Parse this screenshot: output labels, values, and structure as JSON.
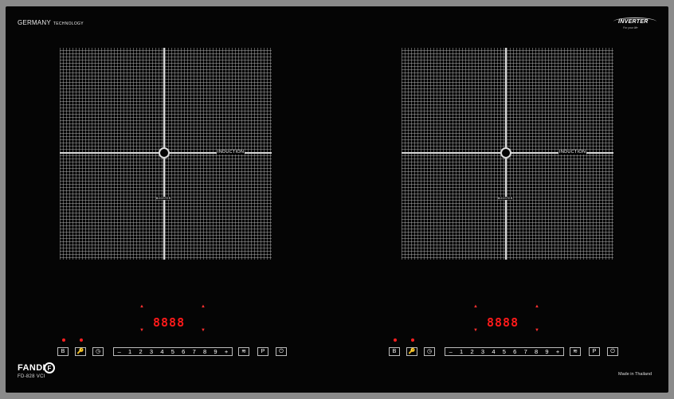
{
  "brand": {
    "top_left": "GERMANY",
    "top_left_small": "TECHNOLOGY",
    "inverter": "INVERTER",
    "inverter_tag": "For your life",
    "logo_name": "FANDI",
    "logo_letter": "F",
    "model": "FD-828 VCI",
    "made_in": "Made in Thailand"
  },
  "zones": [
    {
      "induction_label": "INDUCTION",
      "booster_label": "BOOSTER"
    },
    {
      "induction_label": "INDUCTION",
      "booster_label": "BOOSTER"
    }
  ],
  "panels": [
    {
      "display": "8888",
      "keys": {
        "boost": "B",
        "lock": "🔑",
        "timer": "◷",
        "minus": "–",
        "plus": "+",
        "warm": "≋",
        "pause": "P",
        "power": "⏻"
      },
      "levels": [
        "1",
        "2",
        "3",
        "4",
        "5",
        "6",
        "7",
        "8",
        "9"
      ]
    },
    {
      "display": "8888",
      "keys": {
        "boost": "B",
        "lock": "🔑",
        "timer": "◷",
        "minus": "–",
        "plus": "+",
        "warm": "≋",
        "pause": "P",
        "power": "⏻"
      },
      "levels": [
        "1",
        "2",
        "3",
        "4",
        "5",
        "6",
        "7",
        "8",
        "9"
      ]
    }
  ],
  "colors": {
    "glass": "#050505",
    "frame": "#8a8a8a",
    "led": "#ff1a1a"
  }
}
